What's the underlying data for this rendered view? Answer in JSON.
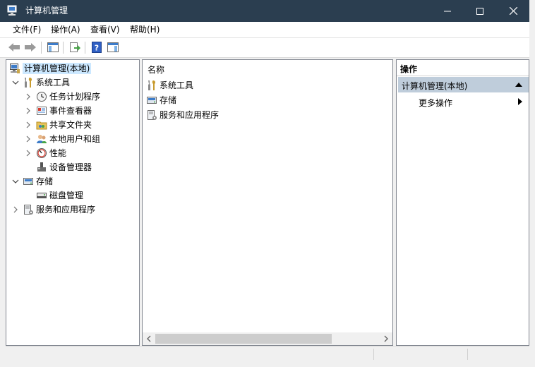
{
  "window": {
    "title": "计算机管理",
    "colors": {
      "titlebar": "#2b3e50",
      "selection": "#cce8ff",
      "action_header": "#bfcddb"
    }
  },
  "caption_buttons": {
    "minimize": "minimize-icon",
    "maximize": "maximize-icon",
    "close": "close-icon"
  },
  "menu": [
    "文件(F)",
    "操作(A)",
    "查看(V)",
    "帮助(H)"
  ],
  "toolbar": [
    "back-arrow-icon",
    "forward-arrow-icon",
    "show-hide-tree-icon",
    "export-list-icon",
    "help-icon",
    "show-hide-action-pane-icon"
  ],
  "tree": {
    "root": "计算机管理(本地)",
    "system_tools": "系统工具",
    "task_scheduler": "任务计划程序",
    "event_viewer": "事件查看器",
    "shared_folders": "共享文件夹",
    "local_users": "本地用户和组",
    "performance": "性能",
    "device_manager": "设备管理器",
    "storage": "存储",
    "disk_management": "磁盘管理",
    "services_apps": "服务和应用程序"
  },
  "list": {
    "column_name": "名称",
    "items": [
      "系统工具",
      "存储",
      "服务和应用程序"
    ]
  },
  "actions": {
    "header": "操作",
    "selected": "计算机管理(本地)",
    "more": "更多操作"
  }
}
